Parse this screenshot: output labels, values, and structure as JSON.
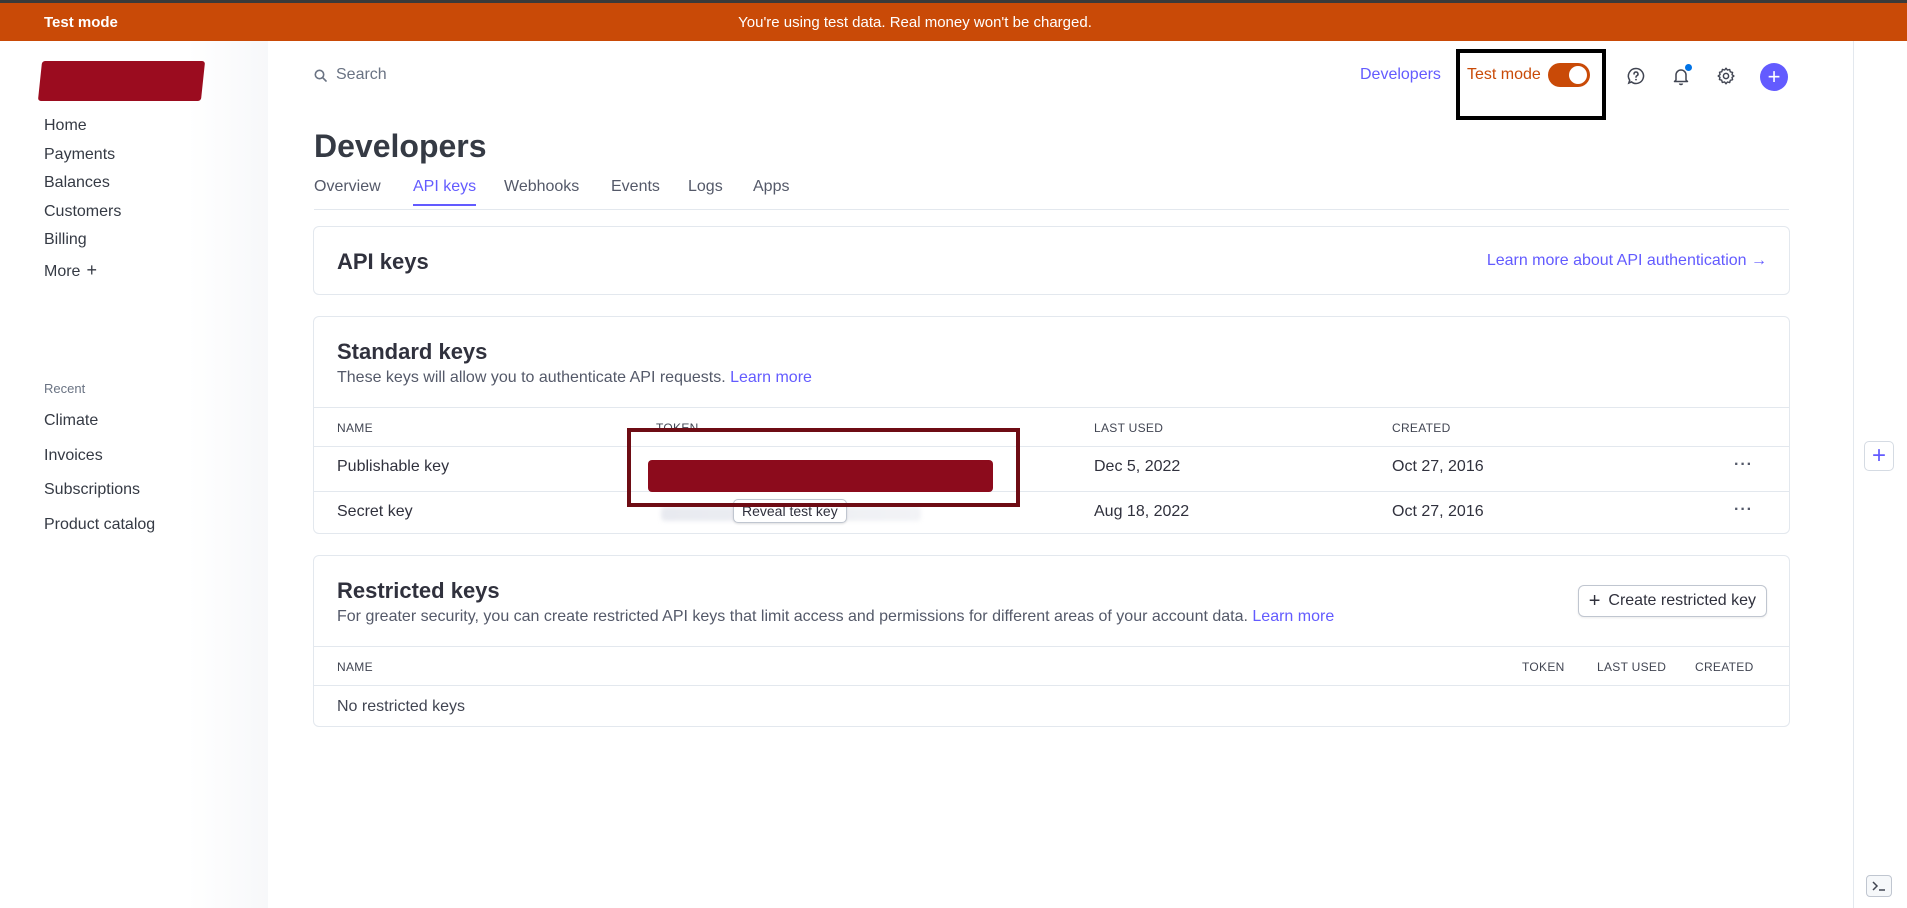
{
  "banner": {
    "label": "Test mode",
    "message": "You're using test data. Real money won't be charged."
  },
  "sidebar": {
    "nav": [
      {
        "label": "Home"
      },
      {
        "label": "Payments"
      },
      {
        "label": "Balances"
      },
      {
        "label": "Customers"
      },
      {
        "label": "Billing"
      },
      {
        "label": "More"
      }
    ],
    "recent_heading": "Recent",
    "recent": [
      {
        "label": "Climate"
      },
      {
        "label": "Invoices"
      },
      {
        "label": "Subscriptions"
      },
      {
        "label": "Product catalog"
      }
    ]
  },
  "topbar": {
    "search_placeholder": "Search",
    "developers_link": "Developers",
    "test_mode_label": "Test mode",
    "test_mode_on": true
  },
  "page": {
    "title": "Developers",
    "tabs": [
      {
        "label": "Overview"
      },
      {
        "label": "API keys",
        "active": true
      },
      {
        "label": "Webhooks"
      },
      {
        "label": "Events"
      },
      {
        "label": "Logs"
      },
      {
        "label": "Apps"
      }
    ]
  },
  "api_keys_card": {
    "title": "API keys",
    "learn_more": "Learn more about API authentication →"
  },
  "standard_keys": {
    "title": "Standard keys",
    "description": "These keys will allow you to authenticate API requests.",
    "learn_more": "Learn more",
    "columns": {
      "name": "NAME",
      "token": "TOKEN",
      "last_used": "LAST USED",
      "created": "CREATED"
    },
    "rows": [
      {
        "name": "Publishable key",
        "last_used": "Dec 5, 2022",
        "created": "Oct 27, 2016"
      },
      {
        "name": "Secret key",
        "last_used": "Aug 18, 2022",
        "created": "Oct 27, 2016",
        "reveal_label": "Reveal test key"
      }
    ],
    "more_actions": "···"
  },
  "restricted_keys": {
    "title": "Restricted keys",
    "description": "For greater security, you can create restricted API keys that limit access and permissions for different areas of your account data.",
    "learn_more": "Learn more",
    "create_button": "Create restricted key",
    "columns": {
      "name": "NAME",
      "token": "TOKEN",
      "last_used": "LAST USED",
      "created": "CREATED"
    },
    "empty_text": "No restricted keys"
  },
  "colors": {
    "accent": "#635bff",
    "test_mode_orange": "#c94a07",
    "redaction": "#8c0b1c"
  }
}
